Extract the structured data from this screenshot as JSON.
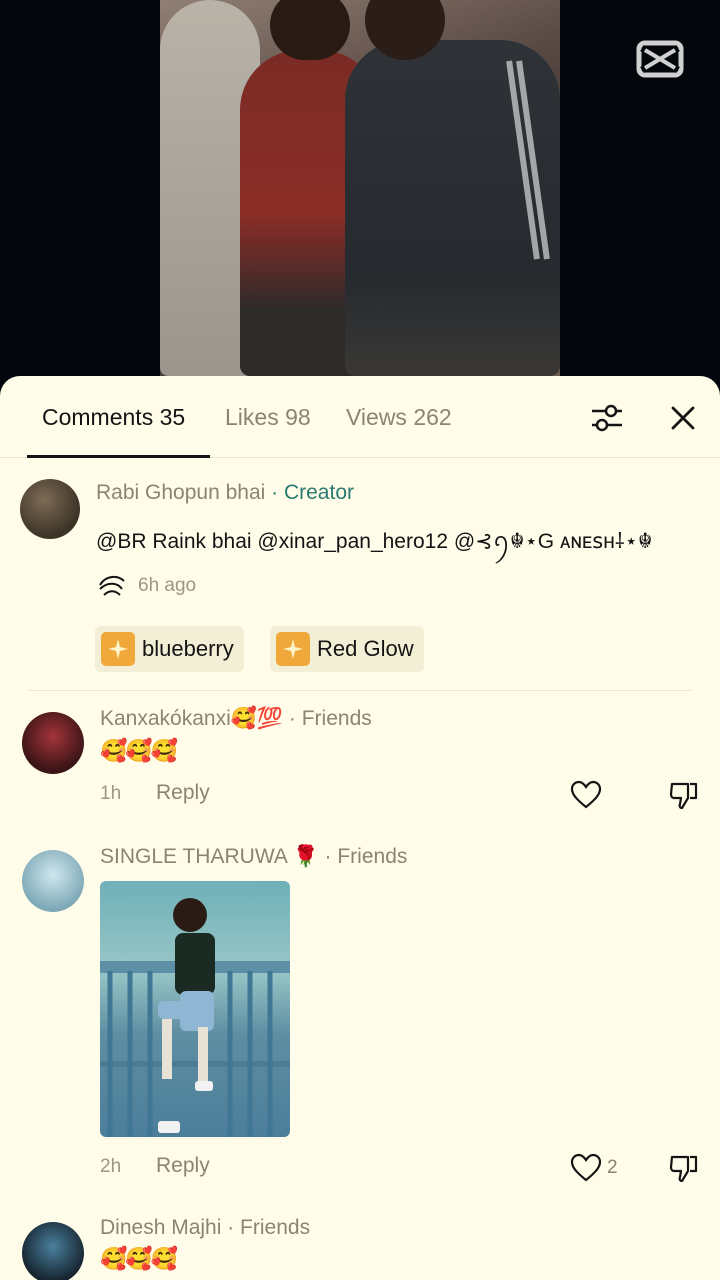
{
  "tabs": [
    {
      "label": "Comments 35"
    },
    {
      "label": "Likes 98"
    },
    {
      "label": "Views 262"
    }
  ],
  "comments": [
    {
      "name": "Rabi Ghopun bhai",
      "role": "· Creator",
      "text": "@BR Raink bhai @xinar_pan_hero12 @⊰ꪆ☬⋆G ᴀɴᴇꜱʜ⸸⋆☬",
      "time": "6h ago",
      "chips": [
        {
          "label": "blueberry"
        },
        {
          "label": "Red Glow"
        }
      ]
    },
    {
      "name": "Kanxakókanxi🥰💯",
      "role": "· Friends",
      "text": "🥰🥰🥰",
      "time": "1h",
      "reply": "Reply"
    },
    {
      "name": "SINGLE THARUWA 🌹",
      "role": "· Friends",
      "time": "2h",
      "reply": "Reply",
      "likes": "2"
    },
    {
      "name": "Dinesh Majhi",
      "role": "· Friends",
      "text": "🥰🥰🥰"
    }
  ],
  "icons": {
    "app": "capcut-logo-icon",
    "filter": "sliders-icon",
    "close": "close-icon",
    "like": "heart-icon",
    "dislike": "dislike-icon",
    "effect": "sparkle-effect-icon"
  },
  "colors": {
    "sheet_bg": "#fffde9",
    "creator": "#2a7a72",
    "muted": "#8a8470",
    "chip_icon": "#f0a83a"
  }
}
